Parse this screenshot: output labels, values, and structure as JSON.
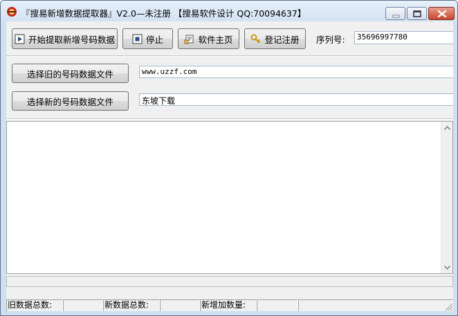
{
  "window": {
    "title": "『搜易新增数据提取器』V2.0—未注册    【搜易软件设计 QQ:70094637】",
    "icon": "app-icon",
    "controls": [
      "minimize-icon",
      "maximize-icon",
      "close-icon"
    ]
  },
  "toolbar": {
    "start_label": "开始提取新增号码数据",
    "stop_label": "停止",
    "home_label": "软件主页",
    "register_label": "登记注册",
    "serial_label": "序列号:",
    "serial_value": "35696997780"
  },
  "files": {
    "old_button": "选择旧的号码数据文件",
    "old_path": "www.uzzf.com",
    "new_button": "选择新的号码数据文件",
    "new_path": "东坡下载"
  },
  "output": {
    "text": ""
  },
  "statusbar": {
    "old_total_label": "旧数据总数:",
    "old_total_value": "",
    "new_total_label": "新数据总数:",
    "new_total_value": "",
    "added_label": "新增加数量:",
    "added_value": ""
  },
  "colors": {
    "title_bg": "#d2e2f3",
    "client_bg": "#f0f0f0",
    "close_btn": "#c9442a"
  }
}
